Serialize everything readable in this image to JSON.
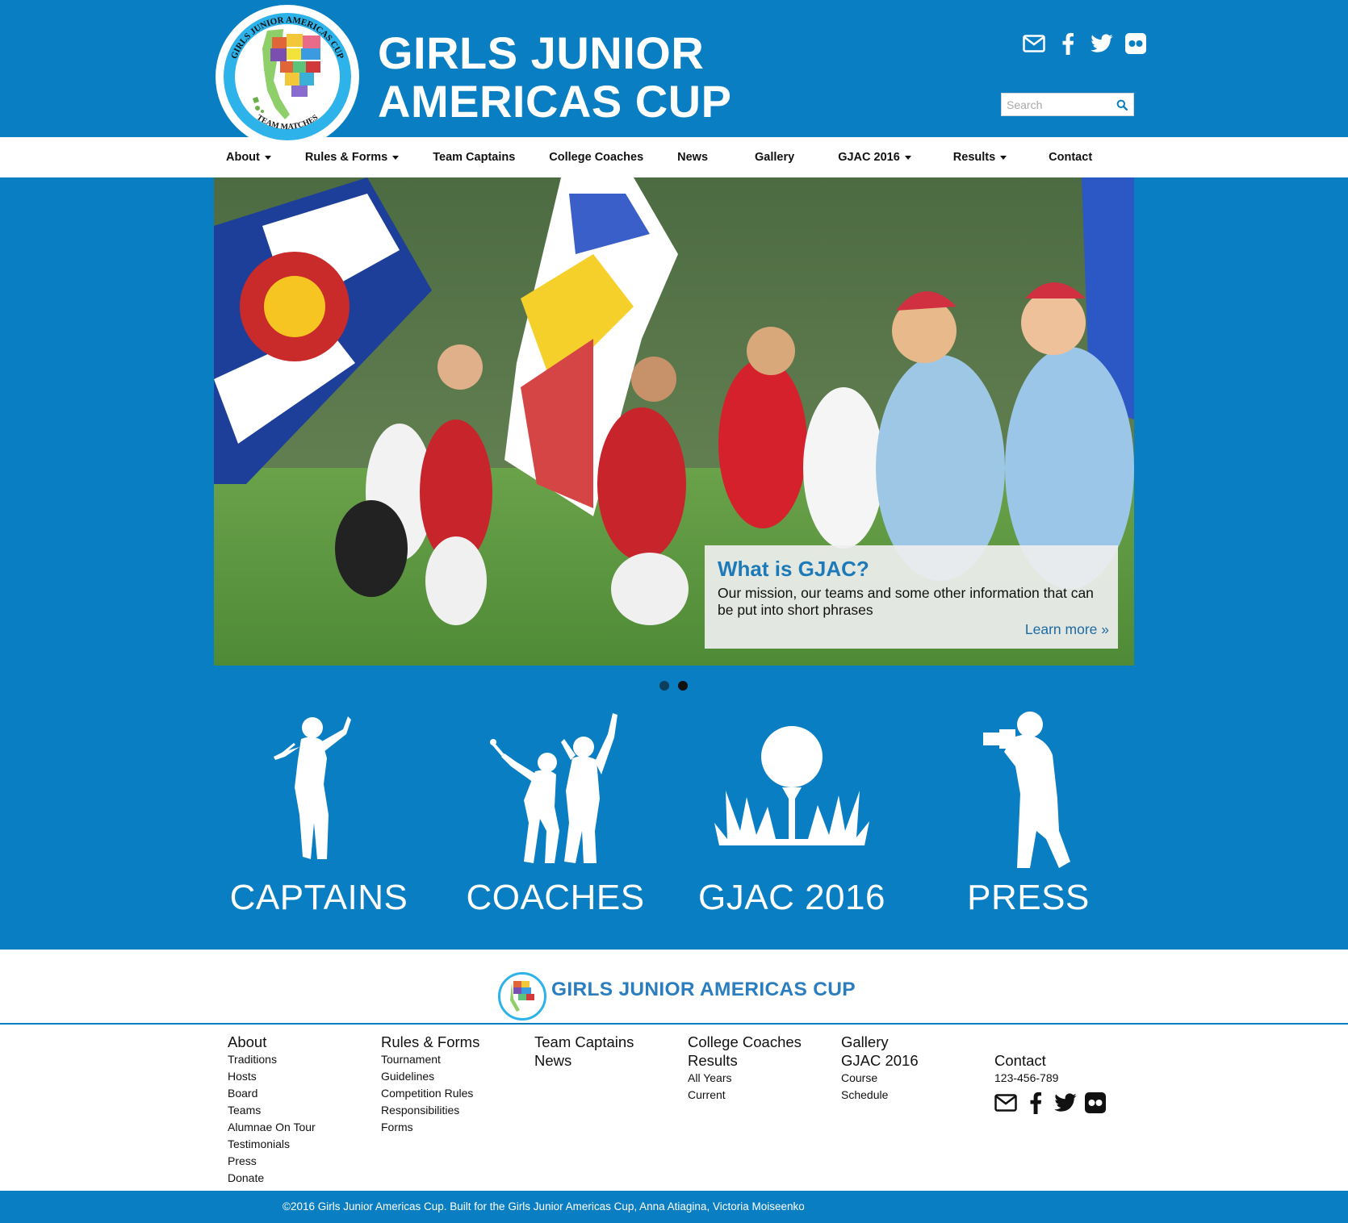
{
  "header": {
    "title_line1": "GIRLS JUNIOR",
    "title_line2": "AMERICAS CUP",
    "social": [
      "envelope-icon",
      "facebook-icon",
      "twitter-icon",
      "flickr-icon"
    ],
    "search_placeholder": "Search"
  },
  "logo": {
    "ring_top_text": "GIRLS JUNIOR AMERICAS CUP",
    "ring_bottom_text": "TEAM MATCHES"
  },
  "nav": {
    "items": [
      {
        "label": "About",
        "dropdown": true
      },
      {
        "label": "Rules & Forms",
        "dropdown": true
      },
      {
        "label": "Team Captains",
        "dropdown": false
      },
      {
        "label": "College Coaches",
        "dropdown": false
      },
      {
        "label": "News",
        "dropdown": false
      },
      {
        "label": "Gallery",
        "dropdown": false
      },
      {
        "label": "GJAC 2016",
        "dropdown": true
      },
      {
        "label": "Results",
        "dropdown": true
      },
      {
        "label": "Contact",
        "dropdown": false
      }
    ]
  },
  "hero": {
    "caption_title": "What is GJAC?",
    "caption_text": "Our mission, our teams and some other information that can be put into short phrases",
    "caption_link": "Learn more »",
    "slides": 2,
    "active_slide": 2
  },
  "tiles": [
    {
      "label": "CAPTAINS",
      "icon": "golfer-swing-icon"
    },
    {
      "label": "COACHES",
      "icon": "coaches-icon"
    },
    {
      "label": "GJAC 2016",
      "icon": "golf-ball-tee-icon"
    },
    {
      "label": "PRESS",
      "icon": "photographer-icon"
    }
  ],
  "footer": {
    "brand": "GIRLS JUNIOR AMERICAS CUP",
    "columns": [
      {
        "headings": [
          "About"
        ],
        "items": [
          "Traditions",
          "Hosts",
          "Board",
          "Teams",
          "Alumnae On Tour",
          "Testimonials",
          "Press",
          "Donate"
        ]
      },
      {
        "headings": [
          "Rules & Forms"
        ],
        "items": [
          "Tournament",
          "Guidelines",
          "Competition Rules",
          "Responsibilities",
          "Forms"
        ]
      },
      {
        "headings": [
          "Team Captains",
          "News"
        ],
        "items": []
      },
      {
        "headings": [
          "College Coaches",
          "Results"
        ],
        "items": [
          "All Years",
          "Current"
        ]
      },
      {
        "headings": [
          "Gallery",
          "GJAC 2016"
        ],
        "items": [
          "Course",
          "Schedule"
        ]
      },
      {
        "headings": [
          "Contact"
        ],
        "items": [
          "123-456-789"
        ]
      }
    ],
    "copyright": "©2016 Girls Junior Americas Cup. Built for the Girls Junior Americas Cup, Anna Atiagina, Victoria Moiseenko"
  },
  "colors": {
    "brand_blue": "#0a7ec2",
    "caption_title": "#1c7ab8",
    "footer_brand": "#2a7ec0"
  }
}
